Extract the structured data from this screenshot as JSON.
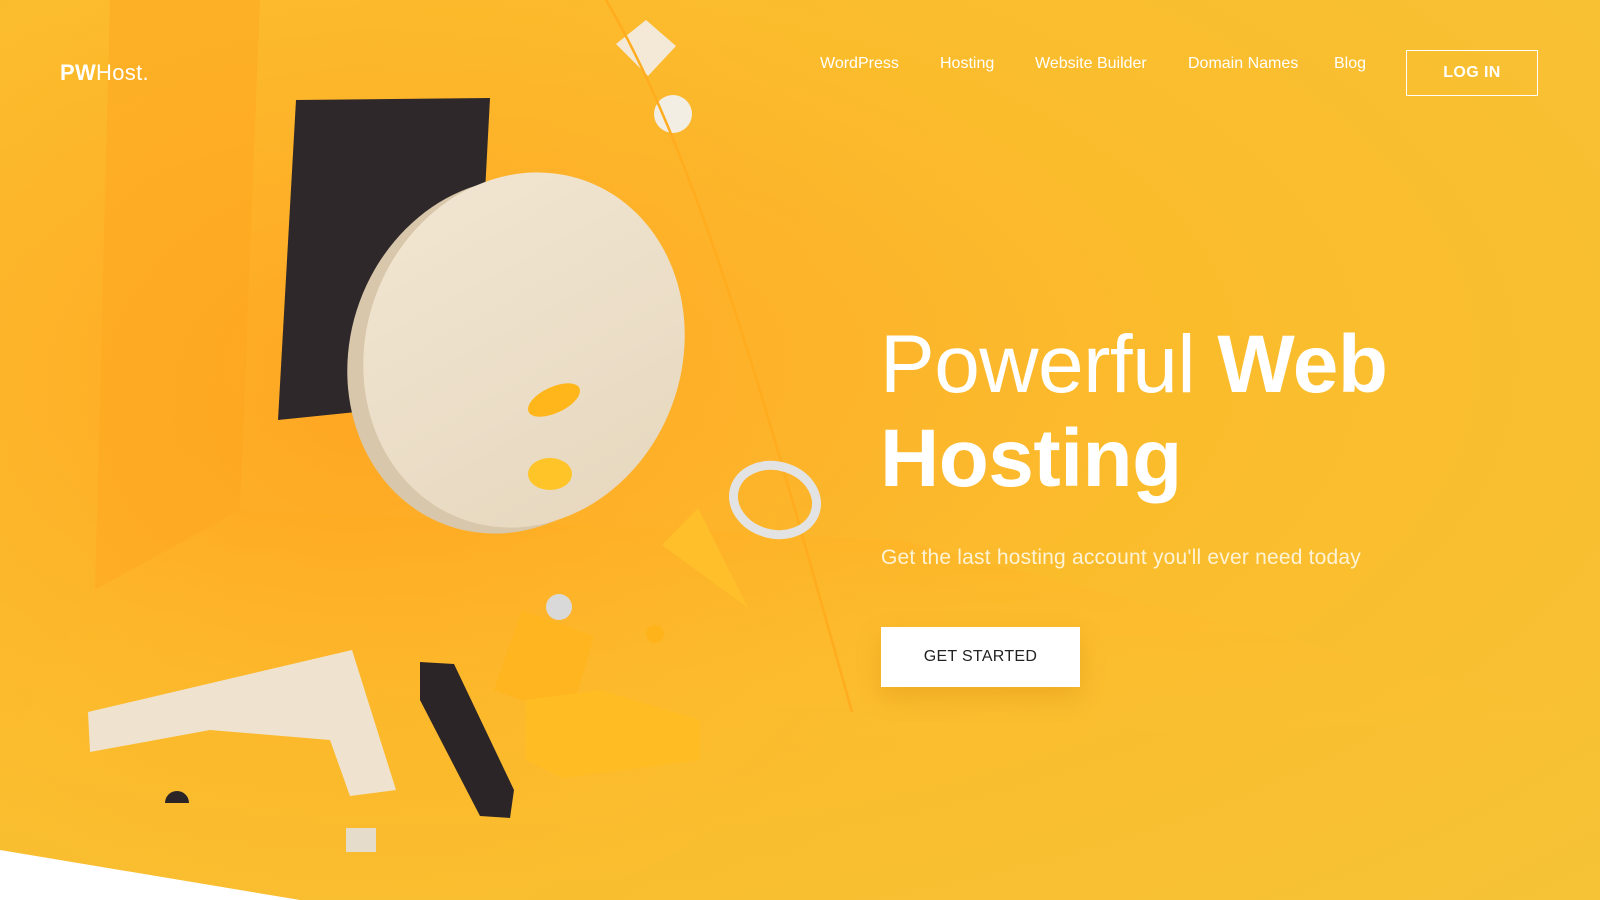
{
  "brand": {
    "logo_bold": "PW",
    "logo_rest": "Host."
  },
  "nav": {
    "items": [
      {
        "label": "WordPress"
      },
      {
        "label": "Hosting"
      },
      {
        "label": "Website Builder"
      },
      {
        "label": "Domain Names"
      },
      {
        "label": "Blog"
      }
    ],
    "login_label": "LOG IN"
  },
  "hero": {
    "headline_light": "Powerful",
    "headline_bold_1": "Web",
    "headline_bold_2": "Hosting",
    "subtitle": "Get the last hosting account you'll ever need today",
    "cta_label": "GET STARTED"
  },
  "colors": {
    "background": "#f8bf2f",
    "accent_dark": "#2c2628",
    "accent_cream": "#efe3cf",
    "text_on_hero": "#ffffff"
  }
}
